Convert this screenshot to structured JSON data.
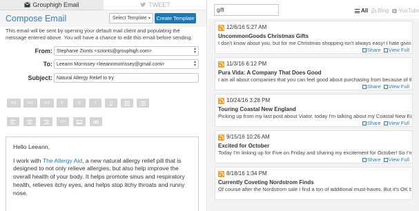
{
  "tabs": [
    {
      "label": "Grouphigh Email",
      "icon": "envelope-icon"
    },
    {
      "label": "TWEET",
      "icon": "twitter-icon"
    }
  ],
  "compose": {
    "title": "Compose Email",
    "template_select": "Select Template",
    "create_template": "Create Template",
    "intro": "This email will be sent by opening your default mail client and populating the message entered above. You will have a chance to edit this email before sending.",
    "from_label": "From:",
    "from_value": "Stephanie Zionts <szionts@grouphigh.com>",
    "to_label": "To:",
    "to_value": "Leeann Morrissey <leeannmorrissey@gmail.com>",
    "subject_label": "Subject:",
    "subject_value": "Natural Allergy Relief to try"
  },
  "toolbar": {
    "row1": [
      "H1",
      "H2",
      "H3",
      "P",
      "B",
      "I",
      "U",
      "list",
      "list"
    ],
    "row2": [
      "align-left",
      "align-center",
      "align-right",
      "</>",
      "image",
      "link"
    ]
  },
  "editor": {
    "greeting": "Hello Leeann,",
    "p_start": "I work with ",
    "link": "The Allergy Aid",
    "p_rest": ", a new natural allergy relief pill that is designed to not only relieve allergies, but also help improve the overall health of your body. It helps promote sinus and respiratory health, relieves itchy eyes, and helps stop itchy throats and runny nose."
  },
  "search": {
    "value": "gift"
  },
  "filters": [
    {
      "label": "All",
      "icon": "list-icon",
      "active": true
    },
    {
      "label": "Blog",
      "icon": "rss-icon",
      "active": false
    },
    {
      "label": "YouTube",
      "icon": "youtube-icon",
      "active": false
    }
  ],
  "actions": {
    "share": "Share",
    "view": "View Full"
  },
  "posts": [
    {
      "date": "12/6/16 5:27 AM",
      "title": "UncommonGoods Christmas Gifts",
      "snippet": "I don't know about you, but for me Christmas shopping isn't always easy! I hate giving ..."
    },
    {
      "date": "11/3/16 6:12 PM",
      "title": "Pura Vida: A Company That Does Good",
      "snippet": "I am all about companies that you can feel good about purchasing from because of th..."
    },
    {
      "date": "10/24/16 3:28 PM",
      "title": "Touring Coastal New England",
      "snippet": "Picking up from my last post about Viator, today I'm talking about my Coastal New Engla..."
    },
    {
      "date": "9/15/16 10:26 AM",
      "title": "Excited for October",
      "snippet": "Today I'm linking up for Five on Friday and sharing my excitement for October! So I'm s..."
    },
    {
      "date": "8/18/16 1:34 PM",
      "title": "Currently Coveting Nordstrom Finds",
      "snippet": "Of course after the Nordstrom sale I find a ton of additional must-haves. But it's OK be..."
    }
  ]
}
